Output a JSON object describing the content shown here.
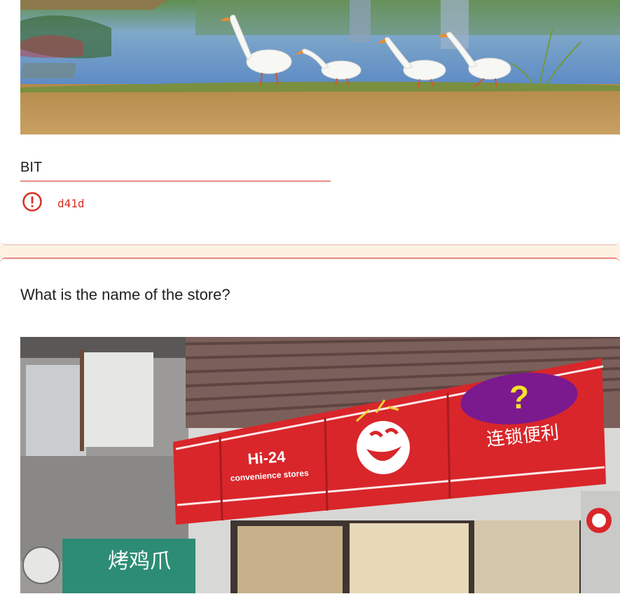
{
  "question1": {
    "answer_value": "BIT",
    "error_message": "d41d",
    "error_icon": "error-circle-icon"
  },
  "question2": {
    "title": "What is the name of the store?",
    "sign_brand": "Hi-24",
    "sign_tagline": "convenience stores",
    "sign_chinese": "连锁便利",
    "shop_sign": "烤鸡爪",
    "overlay_mark": "?"
  },
  "colors": {
    "error": "#d93025",
    "divider": "#fdf1e2",
    "text": "#202124"
  }
}
